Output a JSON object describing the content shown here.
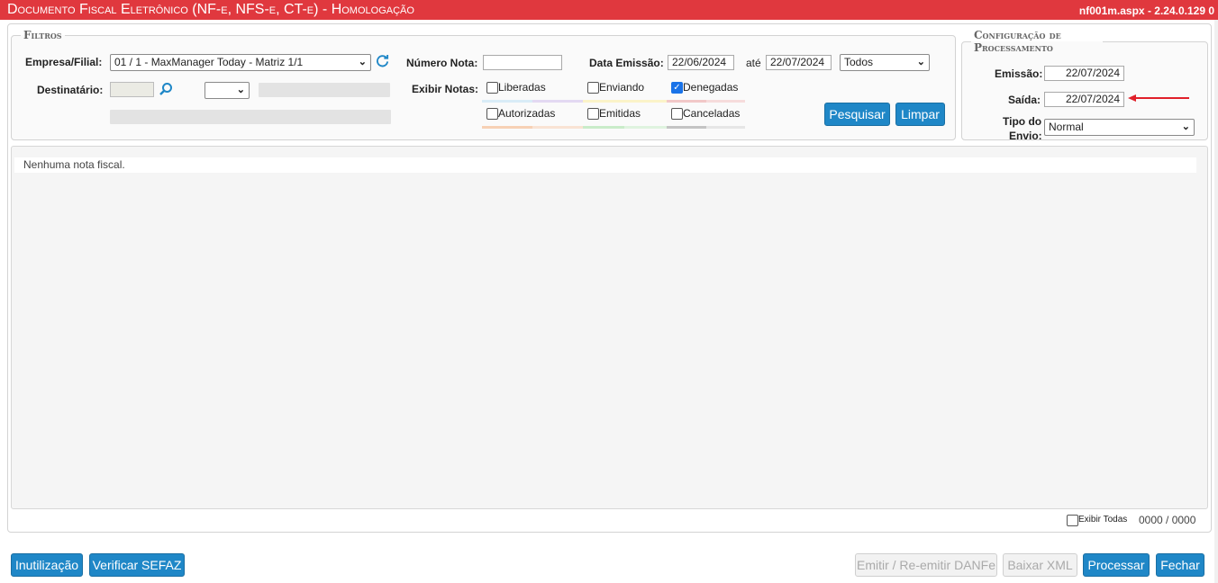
{
  "window": {
    "title": "Documento Fiscal Eletrônico (NF-e, NFS-e, CT-e)  - Homologação",
    "version": "nf001m.aspx - 2.24.0.129  0"
  },
  "filters": {
    "legend": "Filtros",
    "empresa_label": "Empresa/Filial:",
    "empresa_value": "01 / 1 - MaxManager Today - Matriz 1/1",
    "destinatario_label": "Destinatário:",
    "numero_nota_label": "Número Nota:",
    "numero_nota_value": "",
    "data_emissao_label": "Data Emissão:",
    "data_inicio": "22/06/2024",
    "ate_label": "até",
    "data_fim": "22/07/2024",
    "tipo_select": "Todos",
    "exibir_notas_label": "Exibir Notas:",
    "checkboxes": {
      "liberadas": "Liberadas",
      "enviando": "Enviando",
      "denegadas": "Denegadas",
      "autorizadas": "Autorizadas",
      "emitidas": "Emitidas",
      "canceladas": "Canceladas"
    },
    "pesquisar": "Pesquisar",
    "limpar": "Limpar"
  },
  "config": {
    "legend": "Configuração de Processamento",
    "emissao_label": "Emissão:",
    "emissao_value": "22/07/2024",
    "saida_label": "Saída:",
    "saida_value": "22/07/2024",
    "tipo_envio_label_1": "Tipo do",
    "tipo_envio_label_2": "Envio:",
    "tipo_envio_value": "Normal"
  },
  "results": {
    "empty_message": "Nenhuma nota fiscal.",
    "exibir_todas": "Exibir Todas",
    "counter": "0000 / 0000"
  },
  "footer": {
    "inutilizacao": "Inutilização",
    "verificar_sefaz": "Verificar SEFAZ",
    "emitir_danfe": "Emitir / Re-emitir DANFe",
    "baixar_xml": "Baixar XML",
    "processar": "Processar",
    "fechar": "Fechar"
  },
  "colors": {
    "title_bar": "#e0383e",
    "button_primary": "#1f87c7",
    "annotation_arrow": "#e0202a"
  }
}
